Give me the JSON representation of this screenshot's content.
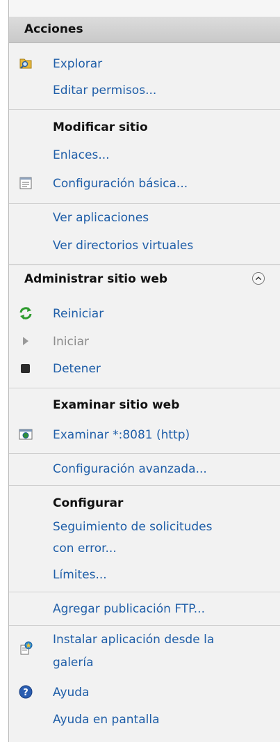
{
  "panel": {
    "title": "Acciones",
    "site_actions": {
      "explore": "Explorar",
      "edit_permissions": "Editar permisos...",
      "modify_heading": "Modificar sitio",
      "bindings": "Enlaces...",
      "basic_settings": "Configuración básica...",
      "view_applications": "Ver aplicaciones",
      "view_virtual_dirs": "Ver directorios virtuales"
    },
    "manage_section": {
      "title": "Administrar sitio web",
      "restart": "Reiniciar",
      "start": "Iniciar",
      "stop": "Detener",
      "browse_heading": "Examinar sitio web",
      "browse_link": "Examinar *:8081 (http)",
      "advanced_settings": "Configuración avanzada...",
      "configure_heading": "Configurar",
      "failed_request_tracing_line1": "Seguimiento de solicitudes",
      "failed_request_tracing_line2": "con error...",
      "limits": "Límites...",
      "add_ftp": "Agregar publicación FTP...",
      "install_gallery_line1": "Instalar aplicación desde la",
      "install_gallery_line2": "galería",
      "help": "Ayuda",
      "online_help": "Ayuda en pantalla"
    },
    "colors": {
      "link": "#1f5ea8",
      "disabled": "#8c8c8c",
      "header_bg": "#d3d3d3"
    }
  }
}
